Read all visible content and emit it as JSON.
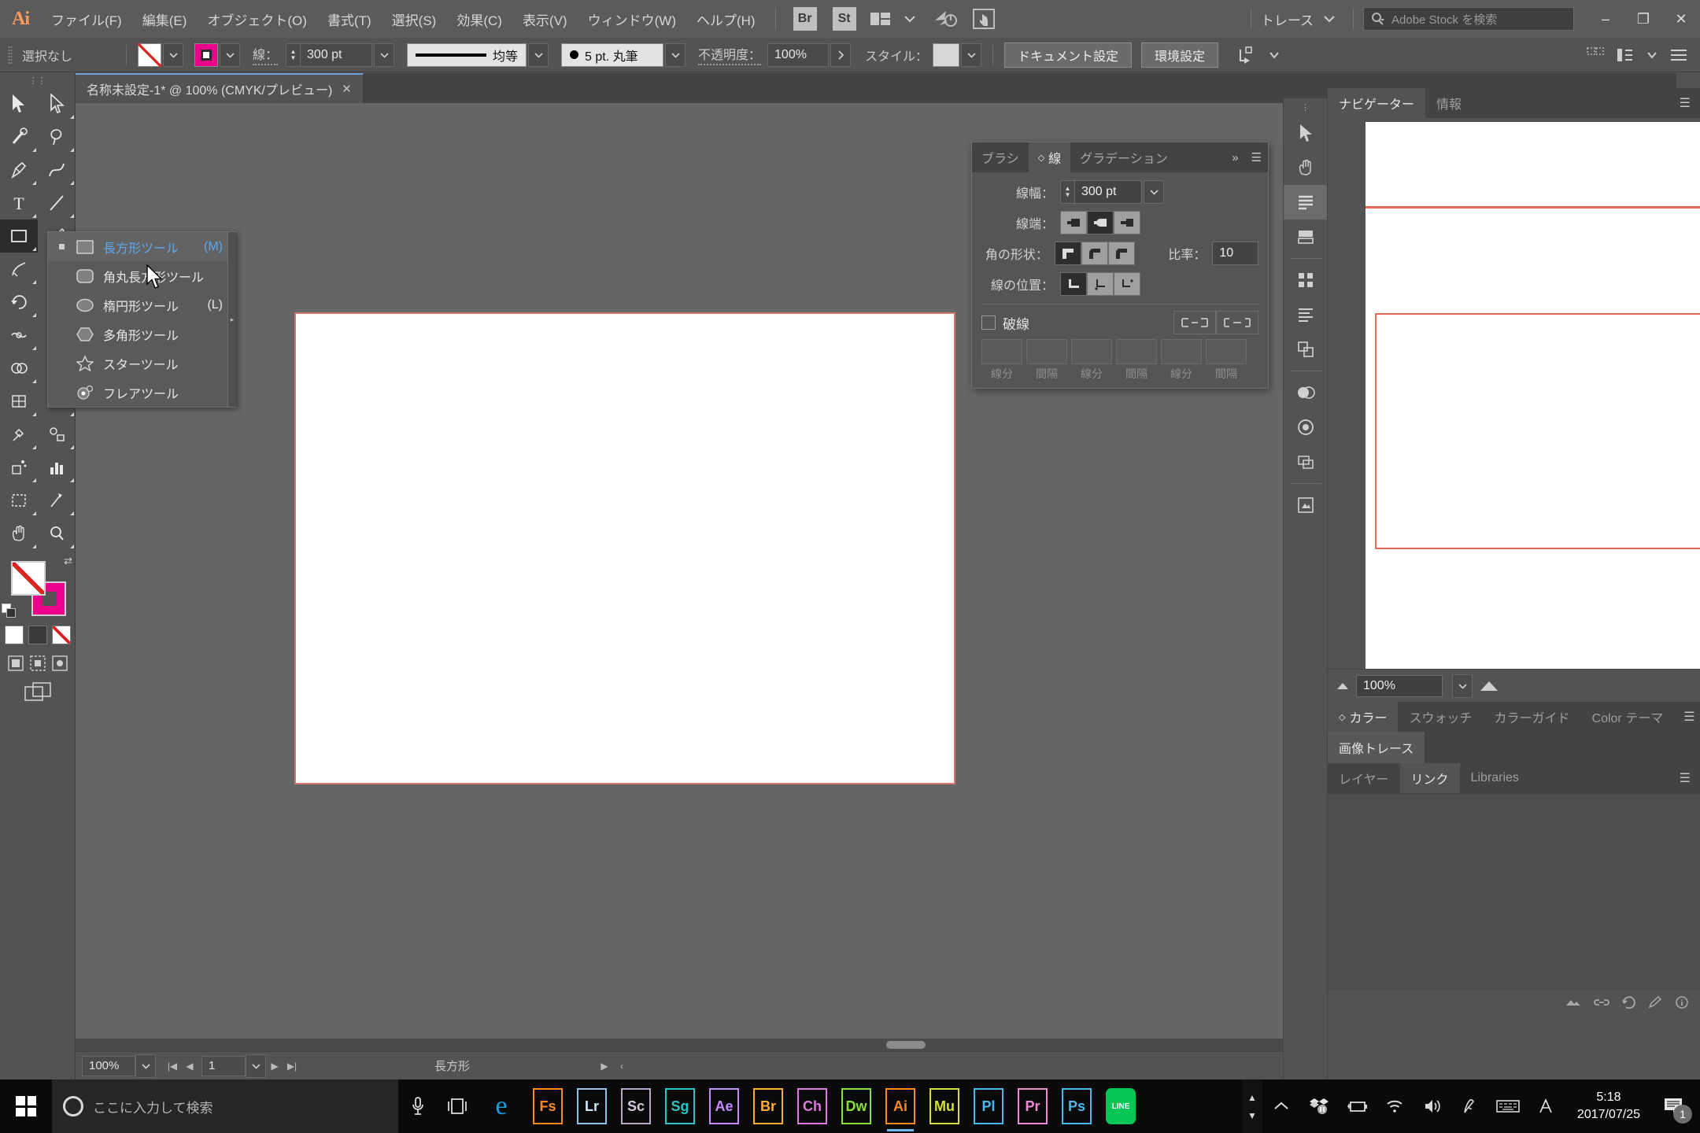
{
  "menubar": {
    "logo": "Ai",
    "items": [
      {
        "label": "ファイル(F)"
      },
      {
        "label": "編集(E)"
      },
      {
        "label": "オブジェクト(O)"
      },
      {
        "label": "書式(T)"
      },
      {
        "label": "選択(S)"
      },
      {
        "label": "効果(C)"
      },
      {
        "label": "表示(V)"
      },
      {
        "label": "ウィンドウ(W)"
      },
      {
        "label": "ヘルプ(H)"
      }
    ],
    "bridge_label": "Br",
    "stock_label": "St",
    "arrange_icon": "arrange-documents-icon",
    "workspace": "トレース",
    "search_placeholder": "Adobe Stock を検索",
    "window_minimize": "–",
    "window_restore": "❐",
    "window_close": "✕"
  },
  "controlbar": {
    "selection_status": "選択なし",
    "fill_label": "fill-none-swatch",
    "stroke_label": "stroke-magenta-swatch",
    "stroke_text": "線：",
    "stroke_weight": "300 pt",
    "profile_label": "均等",
    "brush_label": "5 pt. 丸筆",
    "opacity_text": "不透明度：",
    "opacity_value": "100%",
    "style_text": "スタイル：",
    "doc_setup_button": "ドキュメント設定",
    "preferences_button": "環境設定"
  },
  "flyout": {
    "items": [
      {
        "label": "長方形ツール",
        "key": "(M)",
        "icon": "rectangle-icon",
        "active": true
      },
      {
        "label": "角丸長方形ツール",
        "key": "",
        "icon": "rounded-rectangle-icon",
        "active": false
      },
      {
        "label": "楕円形ツール",
        "key": "(L)",
        "icon": "ellipse-icon",
        "active": false
      },
      {
        "label": "多角形ツール",
        "key": "",
        "icon": "polygon-icon",
        "active": false
      },
      {
        "label": "スターツール",
        "key": "",
        "icon": "star-icon",
        "active": false
      },
      {
        "label": "フレアツール",
        "key": "",
        "icon": "flare-icon",
        "active": false
      }
    ]
  },
  "document": {
    "tab_title": "名称未設定-1* @ 100% (CMYK/プレビュー)",
    "tab_close": "✕"
  },
  "statusbar": {
    "zoom": "100%",
    "page": "1",
    "tool_name": "長方形"
  },
  "stroke_panel": {
    "tabs": [
      {
        "label": "ブラシ",
        "active": false
      },
      {
        "label": "線",
        "active": true
      },
      {
        "label": "グラデーション",
        "active": false
      }
    ],
    "collapse_icon": "»",
    "menu_icon": "☰",
    "weight_label": "線幅：",
    "weight_value": "300 pt",
    "cap_label": "線端：",
    "corner_label": "角の形状：",
    "miter_label": "比率：",
    "miter_value": "10",
    "align_label": "線の位置：",
    "dashed_label": "破線",
    "dash_fields": [
      "線分",
      "間隔",
      "線分",
      "間隔",
      "線分",
      "間隔"
    ]
  },
  "right_dock": {
    "navigator_tabs": [
      {
        "label": "ナビゲーター",
        "active": true
      },
      {
        "label": "情報",
        "active": false
      }
    ],
    "navigator_menu": "☰",
    "navigator_zoom": "100%",
    "color_tabs": [
      {
        "label": "カラー",
        "active": true
      },
      {
        "label": "スウォッチ",
        "active": false
      },
      {
        "label": "カラーガイド",
        "active": false
      },
      {
        "label": "Color テーマ",
        "active": false
      }
    ],
    "color_menu": "☰",
    "trace_tab": "画像トレース",
    "layers_tabs": [
      {
        "label": "レイヤー",
        "active": false
      },
      {
        "label": "リンク",
        "active": true
      },
      {
        "label": "Libraries",
        "active": false
      }
    ],
    "layers_menu": "☰"
  },
  "taskbar": {
    "search_placeholder": "ここに入力して検索",
    "apps": [
      {
        "label": "e",
        "name": "edge-icon",
        "color": "#1a9dd9",
        "border": "none",
        "bg": "transparent"
      },
      {
        "label": "Fs",
        "name": "fuse-icon",
        "color": "#ff8a20",
        "border": "#ff8a20"
      },
      {
        "label": "Lr",
        "name": "lightroom-icon",
        "color": "#cfe6f5",
        "border": "#8fc4e8"
      },
      {
        "label": "Sc",
        "name": "scout-icon",
        "color": "#d6c7e0",
        "border": "#b8a8c8"
      },
      {
        "label": "Sg",
        "name": "speedgrade-icon",
        "color": "#2bc4c4",
        "border": "#2bc4c4"
      },
      {
        "label": "Ae",
        "name": "after-effects-icon",
        "color": "#c58aff",
        "border": "#c58aff"
      },
      {
        "label": "Br",
        "name": "bridge-icon",
        "color": "#ffae33",
        "border": "#ffae33"
      },
      {
        "label": "Ch",
        "name": "character-animator-icon",
        "color": "#e07ae0",
        "border": "#e07ae0"
      },
      {
        "label": "Dw",
        "name": "dreamweaver-icon",
        "color": "#8ae038",
        "border": "#8ae038"
      },
      {
        "label": "Ai",
        "name": "illustrator-icon",
        "color": "#ff8a20",
        "border": "#ff8a20",
        "running": true
      },
      {
        "label": "Mu",
        "name": "muse-icon",
        "color": "#d6e038",
        "border": "#d6e038"
      },
      {
        "label": "Pl",
        "name": "prelude-icon",
        "color": "#4ab8ef",
        "border": "#4ab8ef"
      },
      {
        "label": "Pr",
        "name": "premiere-icon",
        "color": "#ef8ad6",
        "border": "#ef8ad6"
      },
      {
        "label": "Ps",
        "name": "photoshop-icon",
        "color": "#4ab8ef",
        "border": "#4ab8ef"
      },
      {
        "label": "LINE",
        "name": "line-icon",
        "color": "#ffffff",
        "border": "#06c755",
        "bg": "#06c755"
      }
    ],
    "clock_time": "5:18",
    "clock_date": "2017/07/25",
    "notification_count": "1"
  }
}
